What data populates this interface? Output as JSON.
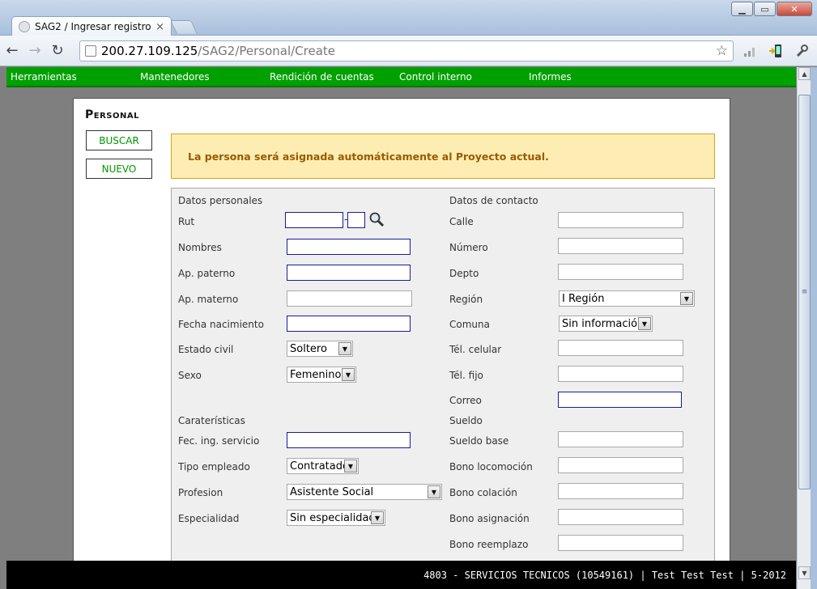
{
  "browser": {
    "tab_title": "SAG2 / Ingresar registro",
    "tab_close": "×",
    "url_host": "200.27.109.125",
    "url_path": "/SAG2/Personal/Create",
    "minimize": "▁",
    "maximize": "▭",
    "close": "✕"
  },
  "menu": {
    "items": [
      "Herramientas",
      "Mantenedores",
      "Rendición de cuentas",
      "Control interno",
      "Informes"
    ]
  },
  "page": {
    "title": "Personal",
    "buscar_label": "BUSCAR",
    "nuevo_label": "NUEVO",
    "notice": "La persona será asignada automáticamente al Proyecto actual."
  },
  "form": {
    "datos_personales": "Datos personales",
    "datos_contacto": "Datos de contacto",
    "caracteristicas": "Caraterísticas",
    "sueldo": "Sueldo",
    "rut_label": "Rut",
    "rut_dash": "-",
    "nombres_label": "Nombres",
    "ap_paterno_label": "Ap. paterno",
    "ap_materno_label": "Ap. materno",
    "fecha_nacimiento_label": "Fecha nacimiento",
    "estado_civil_label": "Estado civil",
    "estado_civil_value": "Soltero",
    "sexo_label": "Sexo",
    "sexo_value": "Femenino",
    "fec_ing_label": "Fec. ing. servicio",
    "tipo_empleado_label": "Tipo empleado",
    "tipo_empleado_value": "Contratado",
    "profesion_label": "Profesion",
    "profesion_value": "Asistente Social",
    "especialidad_label": "Especialidad",
    "especialidad_value": "Sin especialidad",
    "calle_label": "Calle",
    "numero_label": "Número",
    "depto_label": "Depto",
    "region_label": "Región",
    "region_value": "I Región",
    "comuna_label": "Comuna",
    "comuna_value": "Sin información",
    "tel_celular_label": "Tél. celular",
    "tel_fijo_label": "Tél. fijo",
    "correo_label": "Correo",
    "sueldo_base_label": "Sueldo base",
    "bono_locomocion_label": "Bono locomoción",
    "bono_colacion_label": "Bono colación",
    "bono_asignacion_label": "Bono asignación",
    "bono_reemplazo_label": "Bono reemplazo"
  },
  "footer": {
    "status": "4803 - SERVICIOS TECNICOS (10549161) | Test Test Test | 5-2012"
  },
  "colors": {
    "menu_green": "#00a000",
    "notice_bg": "#fdedb2",
    "notice_text": "#9a5a00",
    "button_text": "#009900"
  }
}
